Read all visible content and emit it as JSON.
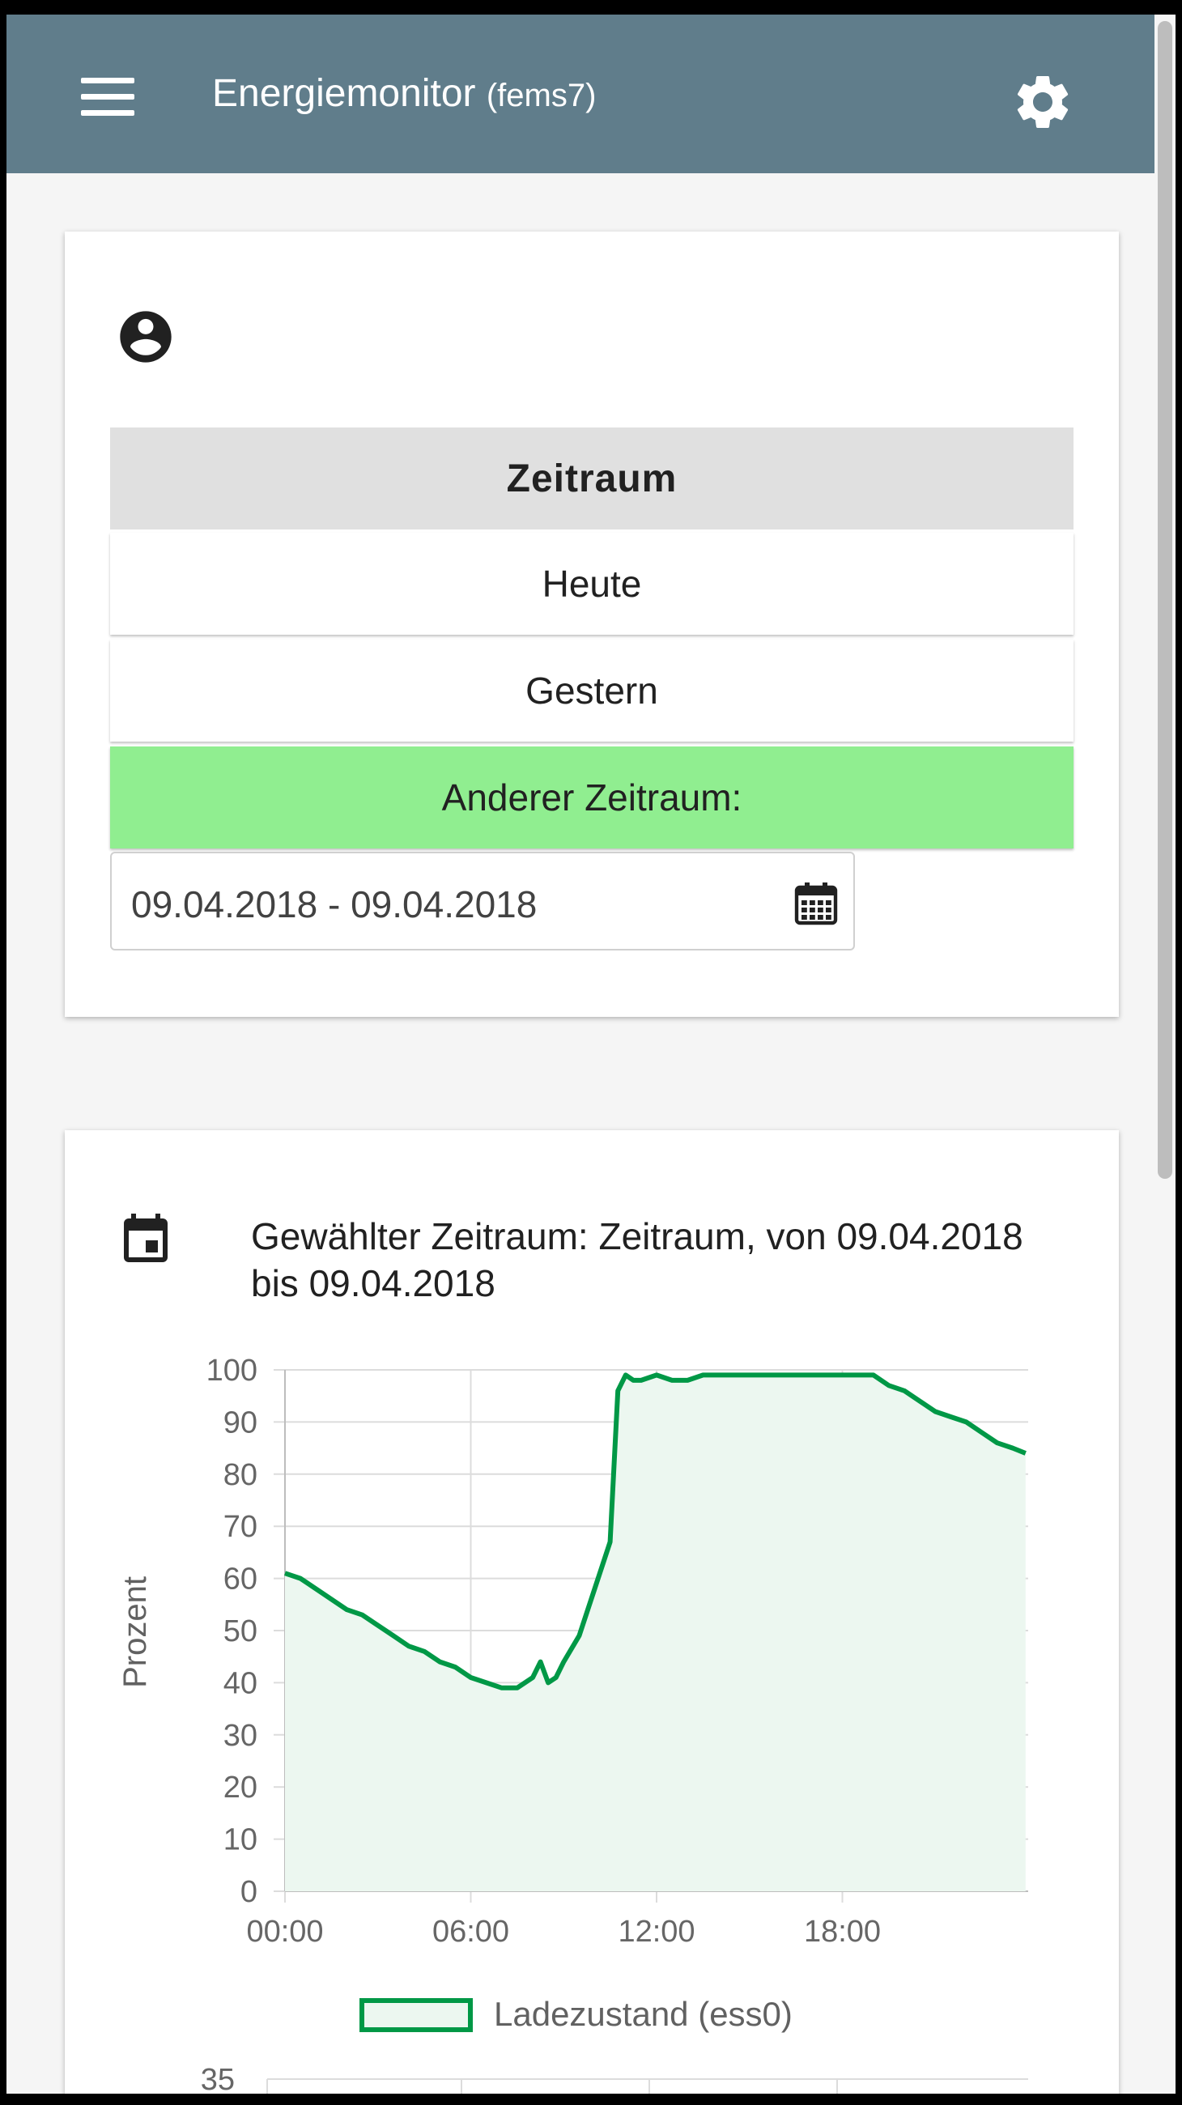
{
  "header": {
    "title": "Energiemonitor",
    "subtitle": "(fems7)",
    "menu_icon": "menu-icon",
    "settings_icon": "gear-icon"
  },
  "period_card": {
    "header": "Zeitraum",
    "options": [
      "Heute",
      "Gestern",
      "Anderer Zeitraum:"
    ],
    "selected": "Anderer Zeitraum:",
    "date_range": "09.04.2018 - 09.04.2018",
    "colors": {
      "selected": "#90ee90",
      "header_bg": "#e0e0e0"
    }
  },
  "chart_card": {
    "heading": "Gewählter Zeitraum: Zeitraum, von 09.04.2018 bis 09.04.2018",
    "legend_label": "Ladezustand (ess0)",
    "next_chart_top_tick": "35"
  },
  "colors": {
    "toolbar": "#607d8b",
    "series_line": "#009846",
    "series_fill": "#ecf7f0"
  },
  "chart_data": {
    "type": "area",
    "title": "",
    "xlabel": "",
    "ylabel": "Prozent",
    "ylim": [
      0,
      100
    ],
    "yticks": [
      0,
      10,
      20,
      30,
      40,
      50,
      60,
      70,
      80,
      90,
      100
    ],
    "xticks": [
      "00:00",
      "06:00",
      "12:00",
      "18:00"
    ],
    "xlim": [
      "00:00",
      "24:00"
    ],
    "grid": true,
    "legend": "bottom",
    "series": [
      {
        "name": "Ladezustand (ess0)",
        "x": [
          "00:00",
          "00:30",
          "01:00",
          "01:30",
          "02:00",
          "02:30",
          "03:00",
          "03:30",
          "04:00",
          "04:30",
          "05:00",
          "05:30",
          "06:00",
          "06:30",
          "07:00",
          "07:30",
          "08:00",
          "08:15",
          "08:30",
          "08:45",
          "09:00",
          "09:30",
          "10:00",
          "10:30",
          "10:45",
          "11:00",
          "11:15",
          "11:30",
          "12:00",
          "12:30",
          "13:00",
          "13:30",
          "14:00",
          "15:00",
          "16:00",
          "17:00",
          "18:00",
          "19:00",
          "19:30",
          "20:00",
          "20:30",
          "21:00",
          "21:30",
          "22:00",
          "22:30",
          "23:00",
          "23:30",
          "23:55"
        ],
        "values": [
          61,
          60,
          58,
          56,
          54,
          53,
          51,
          49,
          47,
          46,
          44,
          43,
          41,
          40,
          39,
          39,
          41,
          44,
          40,
          41,
          44,
          49,
          58,
          67,
          96,
          99,
          98,
          98,
          99,
          98,
          98,
          99,
          99,
          99,
          99,
          99,
          99,
          99,
          97,
          96,
          94,
          92,
          91,
          90,
          88,
          86,
          85,
          84
        ]
      }
    ]
  }
}
